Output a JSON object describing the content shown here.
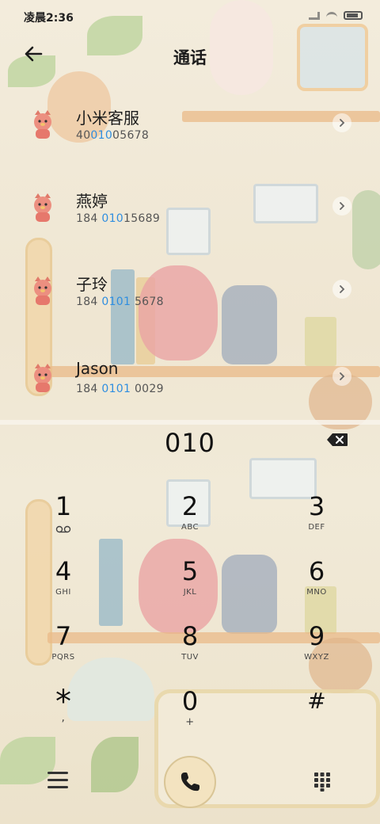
{
  "status_bar": {
    "time": "凌晨2:36"
  },
  "header": {
    "title": "通话"
  },
  "contacts": [
    {
      "name": "小米客服",
      "number_parts": [
        "40",
        "010",
        "05678"
      ]
    },
    {
      "name": "燕婷",
      "number_parts": [
        "184 ",
        "010",
        "15689"
      ]
    },
    {
      "name": "子玲",
      "number_parts": [
        "184 ",
        "0101",
        " 5678"
      ]
    },
    {
      "name": "Jason",
      "number_parts": [
        "184 ",
        "0101",
        " 0029"
      ]
    }
  ],
  "dialer": {
    "input": "010",
    "keys": [
      {
        "digit": "1",
        "letters": ""
      },
      {
        "digit": "2",
        "letters": "ABC"
      },
      {
        "digit": "3",
        "letters": "DEF"
      },
      {
        "digit": "4",
        "letters": "GHI"
      },
      {
        "digit": "5",
        "letters": "JKL"
      },
      {
        "digit": "6",
        "letters": "MNO"
      },
      {
        "digit": "7",
        "letters": "PQRS"
      },
      {
        "digit": "8",
        "letters": "TUV"
      },
      {
        "digit": "9",
        "letters": "WXYZ"
      },
      {
        "digit": "*",
        "letters": ","
      },
      {
        "digit": "0",
        "letters": "+"
      },
      {
        "digit": "#",
        "letters": ""
      }
    ]
  },
  "colors": {
    "highlight": "#2f8ee0",
    "call_button": "#f3e3c0"
  },
  "icons": {
    "back": "back-arrow-icon",
    "backspace": "backspace-icon",
    "chevron": "chevron-right-icon",
    "call": "phone-icon",
    "menu": "menu-icon",
    "keypad": "dialpad-icon",
    "voicemail": "voicemail-icon"
  }
}
